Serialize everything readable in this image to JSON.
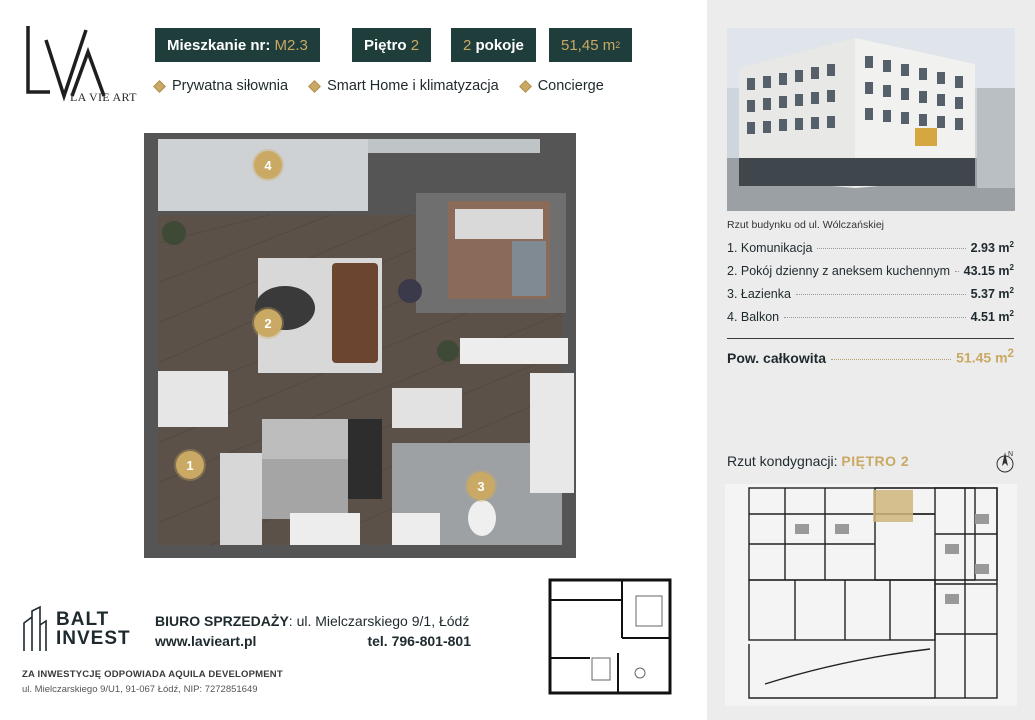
{
  "brand": {
    "name": "LA VIE ART",
    "monogram": "LVA"
  },
  "apartment": {
    "number_label": "Mieszkanie nr:",
    "number_value": "M2.3",
    "floor_label": "Piętro",
    "floor_value": "2",
    "rooms_value": "2",
    "rooms_label": "pokoje",
    "area_value": "51,45 m",
    "area_sup": "2"
  },
  "features": [
    {
      "label": "Prywatna siłownia",
      "icon": "diamond-icon"
    },
    {
      "label": "Smart Home i klimatyzacja",
      "icon": "diamond-icon"
    },
    {
      "label": "Concierge",
      "icon": "diamond-icon"
    }
  ],
  "room_markers": [
    "1",
    "2",
    "3",
    "4"
  ],
  "photo": {
    "caption": "Rzut budynku od ul. Wólczańskiej"
  },
  "areas": [
    {
      "label": "1. Komunikacja",
      "value": "2.93 m",
      "sup": "2"
    },
    {
      "label": "2. Pokój dzienny z aneksem kuchennym",
      "value": "43.15 m",
      "sup": "2"
    },
    {
      "label": "3. Łazienka",
      "value": "5.37 m",
      "sup": "2"
    },
    {
      "label": "4. Balkon",
      "value": "4.51 m",
      "sup": "2"
    }
  ],
  "total": {
    "label": "Pow. całkowita",
    "value": "51.45 m",
    "sup": "2"
  },
  "floor": {
    "label": "Rzut kondygnacji:",
    "value": "PIĘTRO 2",
    "compass": "N"
  },
  "developer": {
    "logo_line1": "BALT",
    "logo_line2": "INVEST",
    "office_label": "BIURO SPRZEDAŻY",
    "office_address": ": ul. Mielczarskiego 9/1, Łódź",
    "website": "www.lavieart.pl",
    "phone": "tel. 796-801-801",
    "legal_title": "ZA INWESTYCJĘ ODPOWIADA AQUILA DEVELOPMENT",
    "legal_address": "ul. Mielczarskiego 9/U1, 91-067 Łódź, NIP: 7272851649"
  },
  "colors": {
    "accent": "#c9a963",
    "badge_bg": "#1f3d3b",
    "panel_bg": "#ececec",
    "text": "#1e2a2e"
  }
}
